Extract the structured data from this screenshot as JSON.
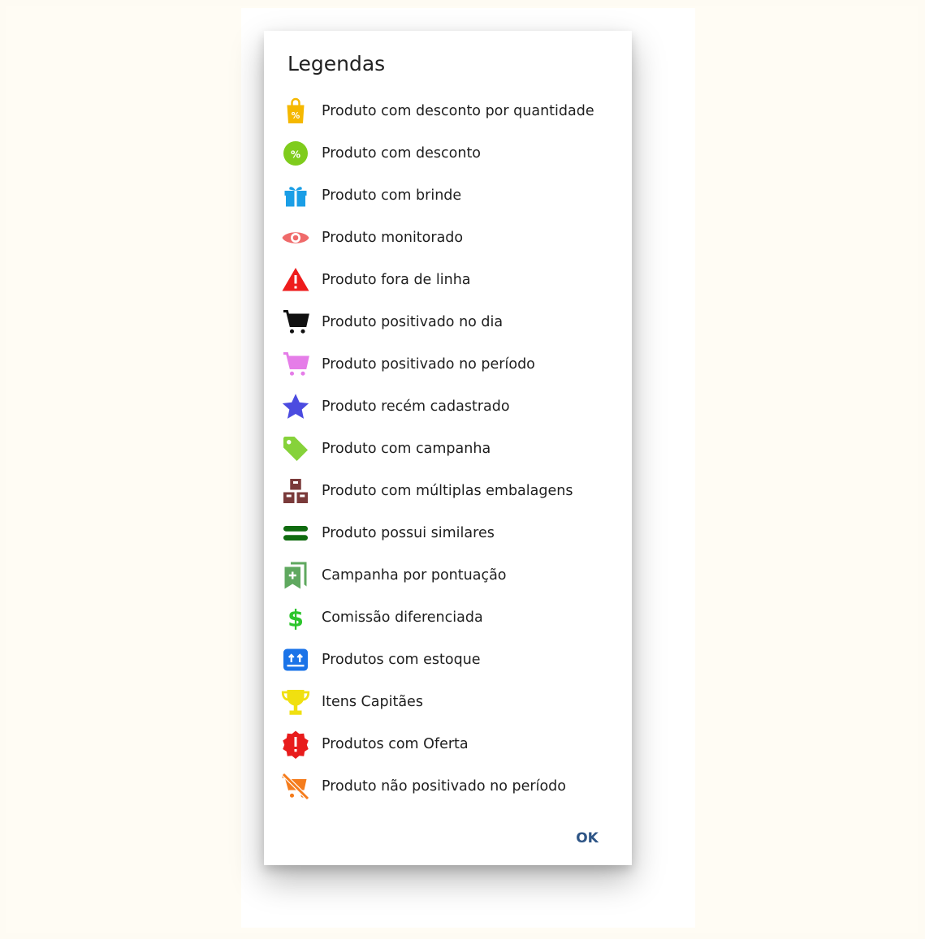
{
  "dialog": {
    "title": "Legendas",
    "ok_label": "OK",
    "items": [
      {
        "label": "Produto com desconto por quantidade",
        "icon": "percent-bag-icon",
        "color": "#f5b800"
      },
      {
        "label": "Produto com desconto",
        "icon": "percent-badge-icon",
        "color": "#7fcc1c"
      },
      {
        "label": "Produto com brinde",
        "icon": "gift-icon",
        "color": "#1a9ee6"
      },
      {
        "label": "Produto monitorado",
        "icon": "eye-icon",
        "color": "#ef6a6a"
      },
      {
        "label": "Produto fora de linha",
        "icon": "warning-icon",
        "color": "#ee1c1c"
      },
      {
        "label": "Produto positivado no dia",
        "icon": "cart-icon",
        "color": "#111111"
      },
      {
        "label": "Produto positivado no período",
        "icon": "cart-period-icon",
        "color": "#e57de8"
      },
      {
        "label": "Produto recém cadastrado",
        "icon": "star-icon",
        "color": "#4b4be0"
      },
      {
        "label": "Produto com campanha",
        "icon": "tag-icon",
        "color": "#86d23a"
      },
      {
        "label": "Produto com múltiplas embalagens",
        "icon": "boxes-icon",
        "color": "#7a3a3a"
      },
      {
        "label": "Produto possui similares",
        "icon": "equals-icon",
        "color": "#0f6b0f"
      },
      {
        "label": "Campanha por pontuação",
        "icon": "bookmarks-icon",
        "color": "#5fa85f"
      },
      {
        "label": "Comissão diferenciada",
        "icon": "dollar-icon",
        "color": "#2dc52d"
      },
      {
        "label": "Produtos com estoque",
        "icon": "stock-box-icon",
        "color": "#1a73e8"
      },
      {
        "label": "Itens Capitães",
        "icon": "trophy-icon",
        "color": "#f0e010"
      },
      {
        "label": "Produtos com Oferta",
        "icon": "offer-badge-icon",
        "color": "#e81c1c"
      },
      {
        "label": "Produto não positivado no período",
        "icon": "cart-off-icon",
        "color": "#f57c1c"
      }
    ]
  }
}
